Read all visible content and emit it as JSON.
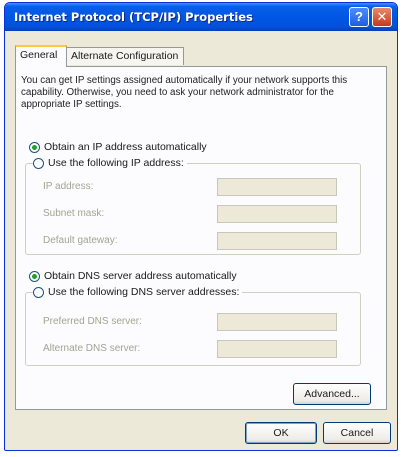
{
  "window": {
    "title": "Internet Protocol (TCP/IP) Properties",
    "help_label": "?",
    "close_label": "✕"
  },
  "tabs": [
    {
      "label": "General",
      "active": true
    },
    {
      "label": "Alternate Configuration",
      "active": false
    }
  ],
  "general": {
    "description": "You can get IP settings assigned automatically if your network supports this capability. Otherwise, you need to ask your network administrator for the appropriate IP settings.",
    "ip": {
      "auto_option": {
        "label": "Obtain an IP address automatically",
        "selected": true
      },
      "manual_option": {
        "label": "Use the following IP address:",
        "selected": false
      },
      "fields": [
        {
          "label": "IP address:",
          "value": ""
        },
        {
          "label": "Subnet mask:",
          "value": ""
        },
        {
          "label": "Default gateway:",
          "value": ""
        }
      ]
    },
    "dns": {
      "auto_option": {
        "label": "Obtain DNS server address automatically",
        "selected": true
      },
      "manual_option": {
        "label": "Use the following DNS server addresses:",
        "selected": false
      },
      "fields": [
        {
          "label": "Preferred DNS server:",
          "value": ""
        },
        {
          "label": "Alternate DNS server:",
          "value": ""
        }
      ]
    },
    "advanced_label": "Advanced..."
  },
  "footer": {
    "ok_label": "OK",
    "cancel_label": "Cancel"
  },
  "colors": {
    "title_bar": "#0057e5",
    "radio_selected": "#21a121",
    "dialog_face": "#ece9d8"
  }
}
